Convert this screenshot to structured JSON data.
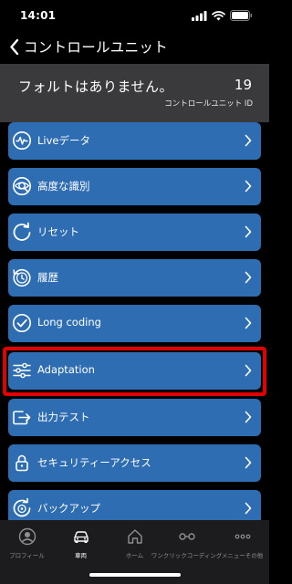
{
  "status_bar": {
    "time": "14:01"
  },
  "nav": {
    "title": "コントロールユニット"
  },
  "summary": {
    "message": "フォルトはありません。",
    "count": "19",
    "label": "コントロールユニット ID"
  },
  "menu": {
    "items": [
      {
        "label": "Liveデータ",
        "icon": "pulse-icon"
      },
      {
        "label": "高度な識別",
        "icon": "identification-icon"
      },
      {
        "label": "リセット",
        "icon": "reset-icon"
      },
      {
        "label": "履歴",
        "icon": "history-icon"
      },
      {
        "label": "Long coding",
        "icon": "check-circle-icon"
      },
      {
        "label": "Adaptation",
        "icon": "sliders-icon"
      },
      {
        "label": "出力テスト",
        "icon": "output-test-icon"
      },
      {
        "label": "セキュリティーアクセス",
        "icon": "lock-icon"
      },
      {
        "label": "バックアップ",
        "icon": "backup-icon"
      }
    ],
    "highlighted_item": "Adaptation",
    "highlight_color": "#e30000",
    "item_color": "#2f6db3"
  },
  "tabs": [
    {
      "label": "プロフィール",
      "icon": "profile-icon",
      "active": false
    },
    {
      "label": "車両",
      "icon": "car-icon",
      "active": true
    },
    {
      "label": "ホーム",
      "icon": "home-icon",
      "active": false
    },
    {
      "label": "ワンクリックコーディング",
      "icon": "one-click-coding-icon",
      "active": false
    },
    {
      "label": "メニューその他",
      "icon": "more-icon",
      "active": false
    }
  ]
}
